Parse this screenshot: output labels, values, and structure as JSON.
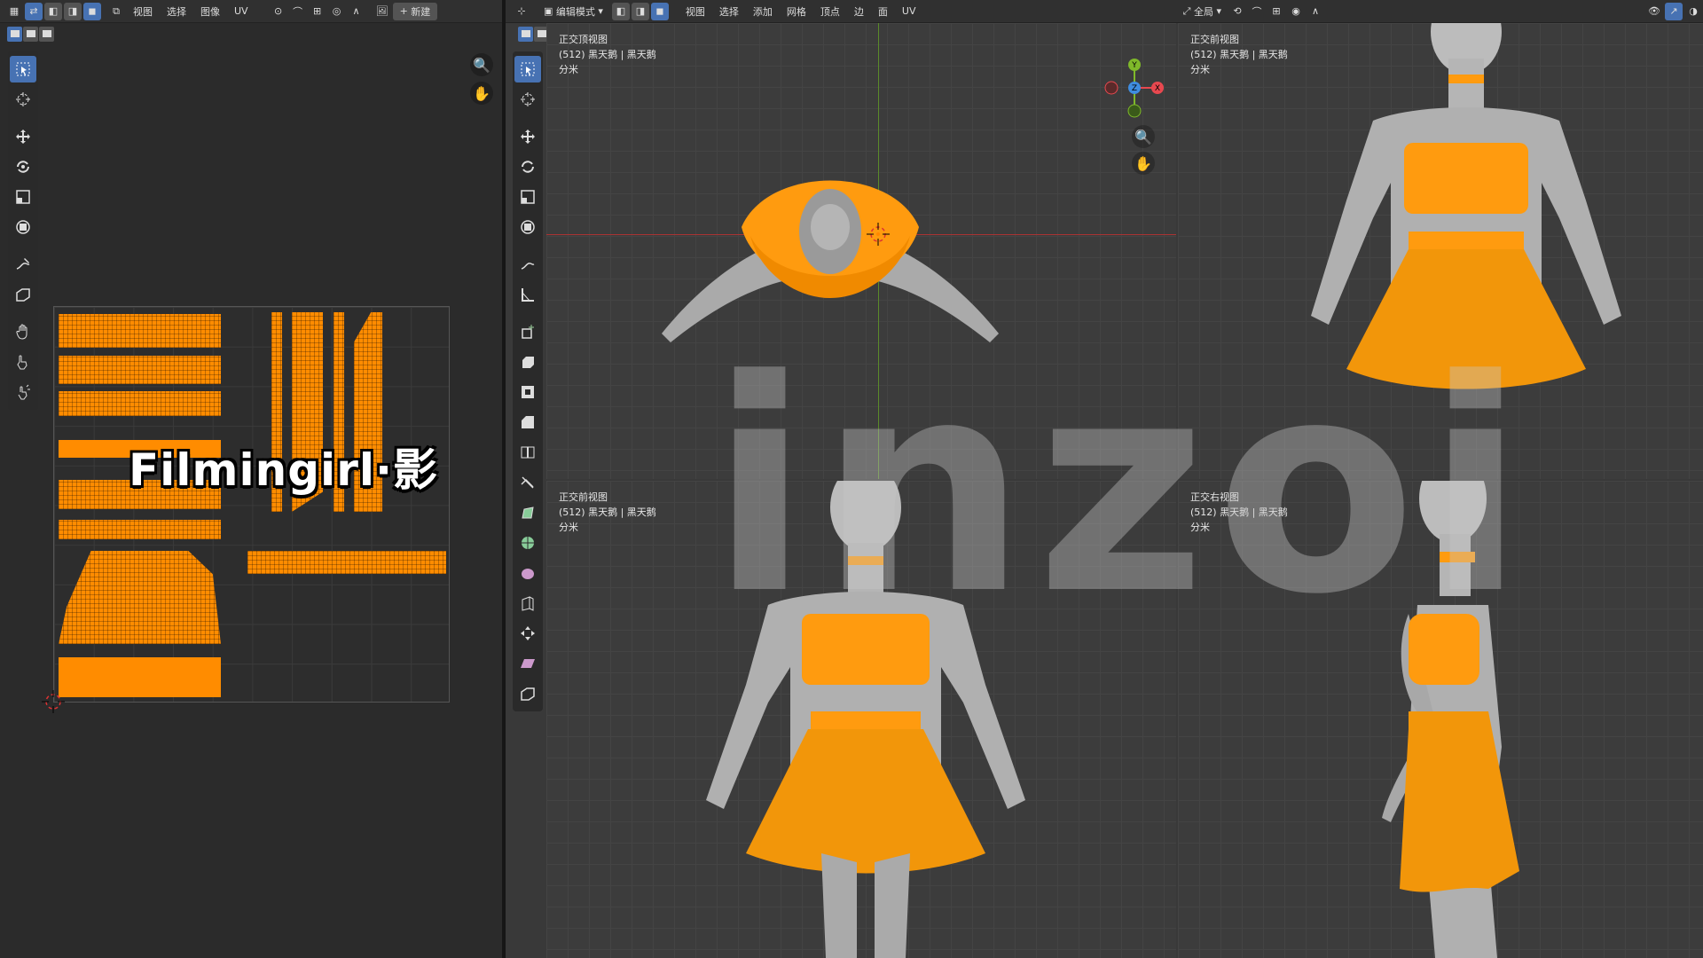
{
  "uv_header": {
    "menus": [
      "视图",
      "选择",
      "图像",
      "UV"
    ],
    "new_button": "新建"
  },
  "vp_header": {
    "mode": "编辑模式",
    "menus": [
      "视图",
      "选择",
      "添加",
      "网格",
      "顶点",
      "边",
      "面",
      "UV"
    ],
    "orientation": "全局"
  },
  "viewports": [
    {
      "title": "正交顶视图",
      "object": "(512) 黑天鹅 | 黑天鹅",
      "unit": "分米"
    },
    {
      "title": "正交前视图",
      "object": "(512) 黑天鹅 | 黑天鹅",
      "unit": "分米"
    },
    {
      "title": "正交前视图",
      "object": "(512) 黑天鹅 | 黑天鹅",
      "unit": "分米"
    },
    {
      "title": "正交右视图",
      "object": "(512) 黑天鹅 | 黑天鹅",
      "unit": "分米"
    }
  ],
  "gizmo_axes": {
    "x": "X",
    "y": "Y",
    "z": "Z"
  },
  "watermarks": {
    "brand": "Filmingirl·影",
    "logo": "inzoi"
  },
  "colors": {
    "accent": "#4772b3",
    "mesh": "#ff8c00",
    "x_axis": "#e8484f",
    "y_axis": "#7fb92a",
    "z_axis": "#3f8de0"
  }
}
